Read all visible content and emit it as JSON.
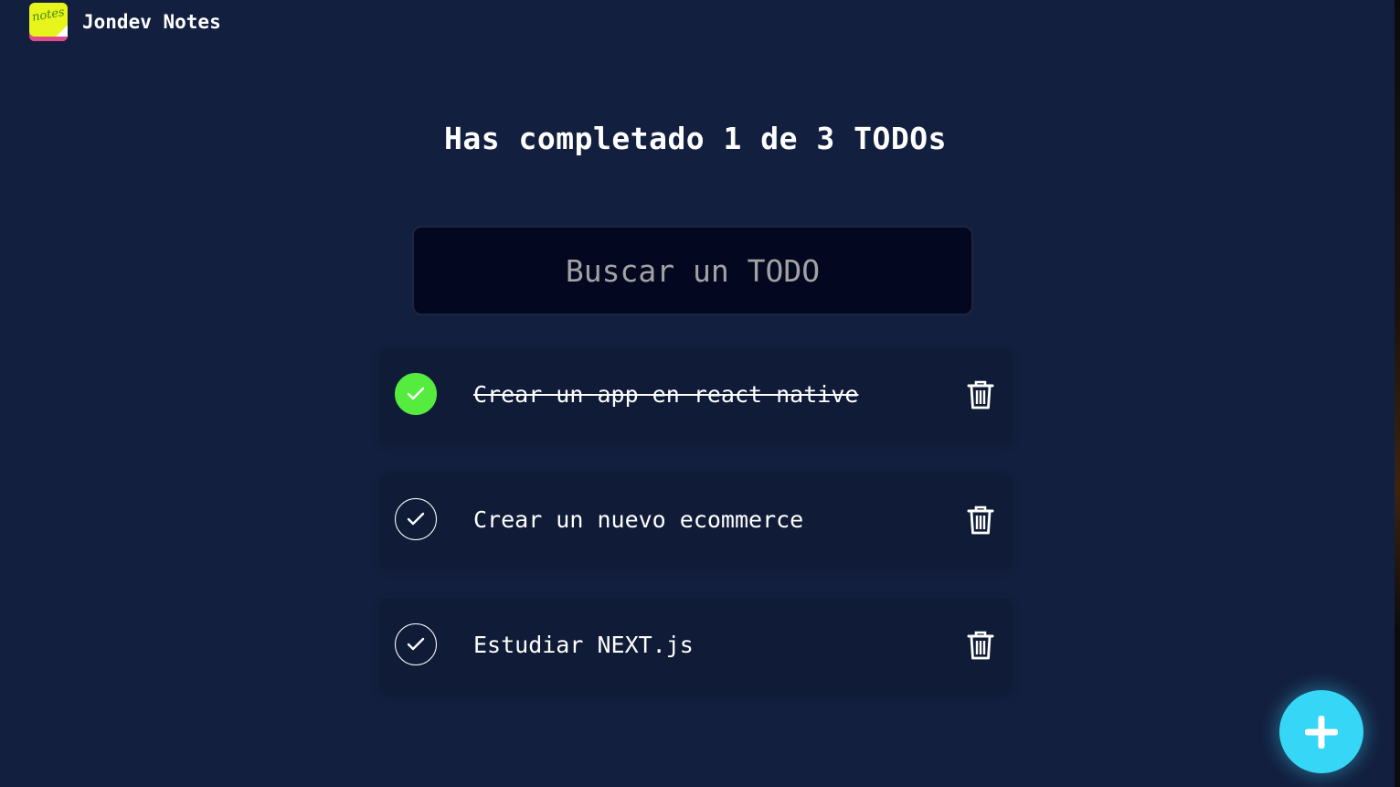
{
  "app": {
    "title": "Jondev Notes",
    "logo_text": "notes"
  },
  "counter": {
    "text": "Has completado 1 de 3 TODOs",
    "completed": 1,
    "total": 3
  },
  "search": {
    "placeholder": "Buscar un TODO",
    "value": ""
  },
  "todos": [
    {
      "text": "Crear un app en react native",
      "completed": true
    },
    {
      "text": "Crear un nuevo ecommerce",
      "completed": false
    },
    {
      "text": "Estudiar NEXT.js",
      "completed": false
    }
  ],
  "icons": {
    "check": "check-icon",
    "delete": "trash-icon",
    "add": "plus-icon"
  },
  "colors": {
    "background": "#131f3f",
    "card": "#101c37",
    "search_bg": "#030820",
    "completed_green": "#55ec3f",
    "fab_cyan": "#36d7f6"
  }
}
